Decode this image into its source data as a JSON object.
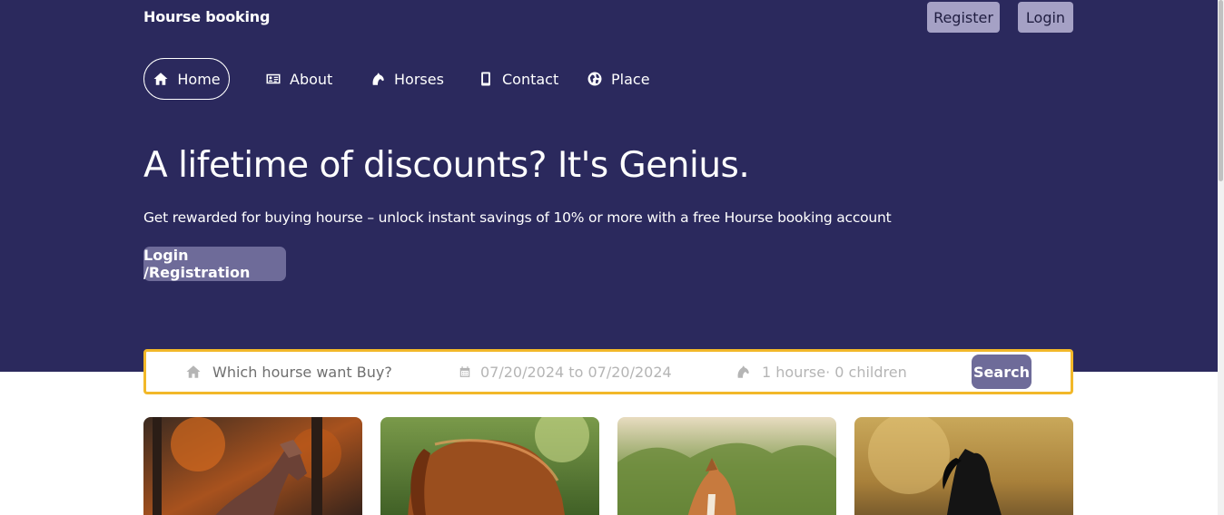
{
  "header": {
    "brand": "Hourse booking",
    "register_label": "Register",
    "login_label": "Login"
  },
  "nav": {
    "items": [
      {
        "label": "Home",
        "icon": "home-icon"
      },
      {
        "label": "About",
        "icon": "id-card-icon"
      },
      {
        "label": "Horses",
        "icon": "horse-icon"
      },
      {
        "label": "Contact",
        "icon": "mobile-icon"
      },
      {
        "label": "Place",
        "icon": "globe-icon"
      }
    ]
  },
  "hero": {
    "headline": "A lifetime of discounts? It's Genius.",
    "subline": "Get rewarded for buying hourse – unlock instant savings of 10% or more with a free Hourse booking account",
    "cta_label": "Login /Registration"
  },
  "search": {
    "where_placeholder": "Which hourse want Buy?",
    "dates": "07/20/2024 to 07/20/2024",
    "guests": "1 hourse· 0 children",
    "button_label": "Search"
  },
  "cards": [
    {
      "image": "horse-photo-autumn-forest"
    },
    {
      "image": "horse-photo-chestnut-grass"
    },
    {
      "image": "horse-photo-palomino-field"
    },
    {
      "image": "horse-photo-black-sunset"
    }
  ],
  "colors": {
    "hero_bg": "#2b295d",
    "accent": "#6e6b99",
    "top_button": "#a5a1c5",
    "search_border": "#f2b829"
  }
}
